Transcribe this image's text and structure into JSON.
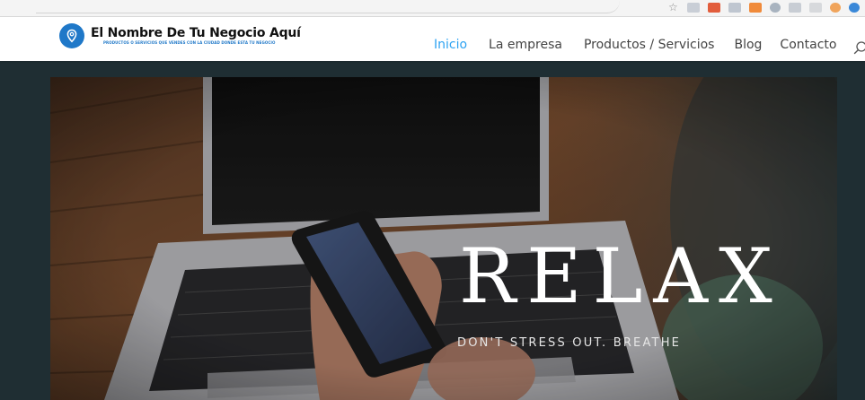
{
  "site": {
    "title": "El Nombre De Tu Negocio Aquí",
    "tagline": "PRODUCTOS O SERVICIOS QUE VENDES CON LA CIUDAD DONDE ESTA TU NEGOCIO"
  },
  "nav": {
    "items": [
      {
        "label": "Inicio",
        "active": true
      },
      {
        "label": "La empresa",
        "active": false
      },
      {
        "label": "Productos / Servicios",
        "active": false
      },
      {
        "label": "Blog",
        "active": false
      },
      {
        "label": "Contacto",
        "active": false
      }
    ],
    "search_icon": "search-icon"
  },
  "hero": {
    "title": "RELAX",
    "subtitle": "DON'T STRESS OUT. BREATHE"
  },
  "colors": {
    "accent": "#2ea3f2",
    "logo": "#1f78c8",
    "page_bg": "#1f2e33"
  }
}
